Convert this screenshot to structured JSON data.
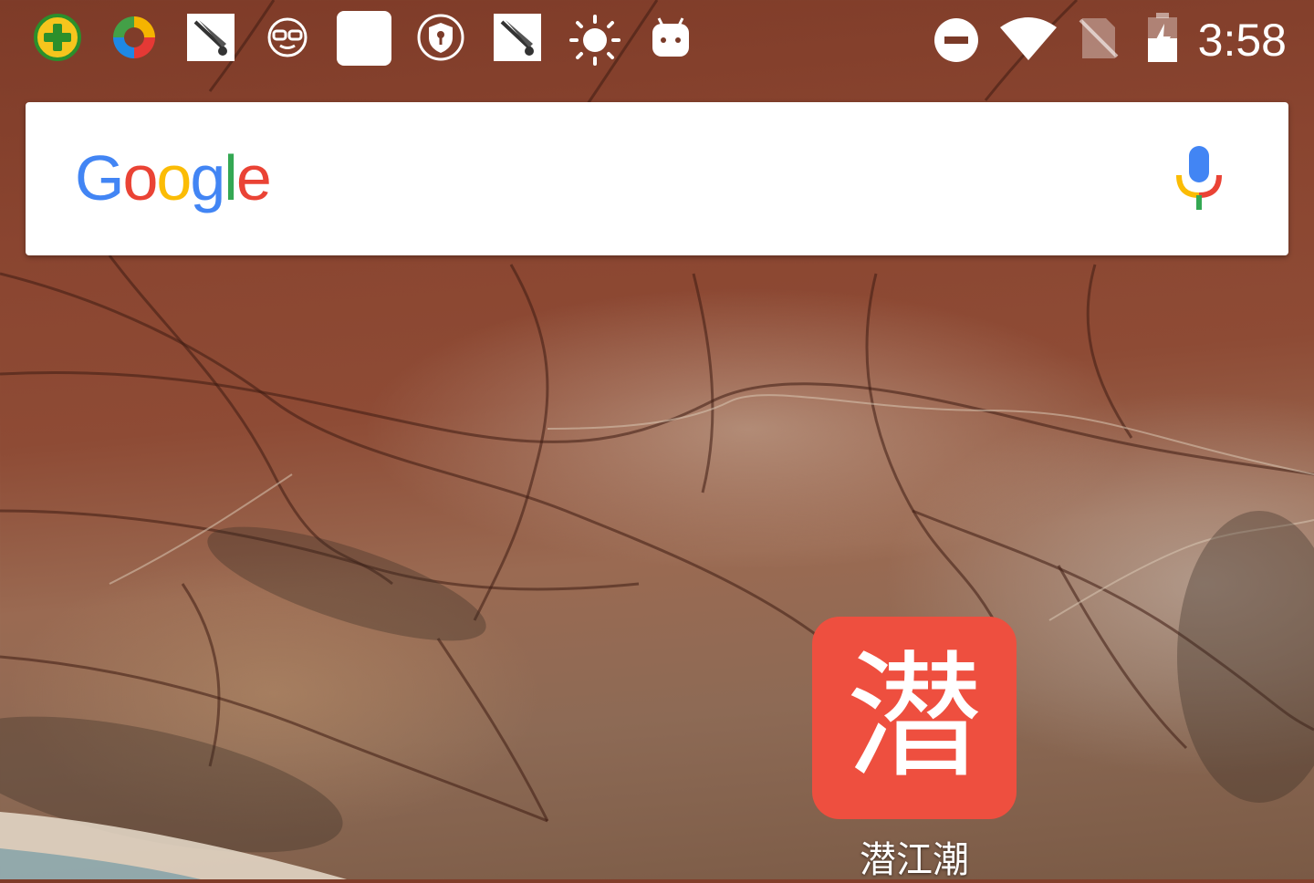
{
  "status_bar": {
    "notification_icons": [
      "plus-badge-icon",
      "colorful-ring-icon",
      "sword-app-icon",
      "sunglasses-face-icon",
      "blank-square-icon",
      "shield-key-icon",
      "sword-app-icon",
      "brightness-icon",
      "android-robot-icon"
    ],
    "system_icons": [
      "do-not-disturb-icon",
      "wifi-icon",
      "no-sim-icon",
      "battery-charging-icon"
    ],
    "time": "3:58"
  },
  "search_widget": {
    "logo_letters": [
      "G",
      "o",
      "o",
      "g",
      "l",
      "e"
    ],
    "mic_icon": "mic-icon"
  },
  "home_apps": [
    {
      "label": "潜江潮",
      "glyph": "潜",
      "icon_color": "#ee4f3f"
    }
  ],
  "colors": {
    "google_blue": "#4285F4",
    "google_red": "#EA4335",
    "google_yellow": "#FBBC05",
    "google_green": "#34A853"
  }
}
